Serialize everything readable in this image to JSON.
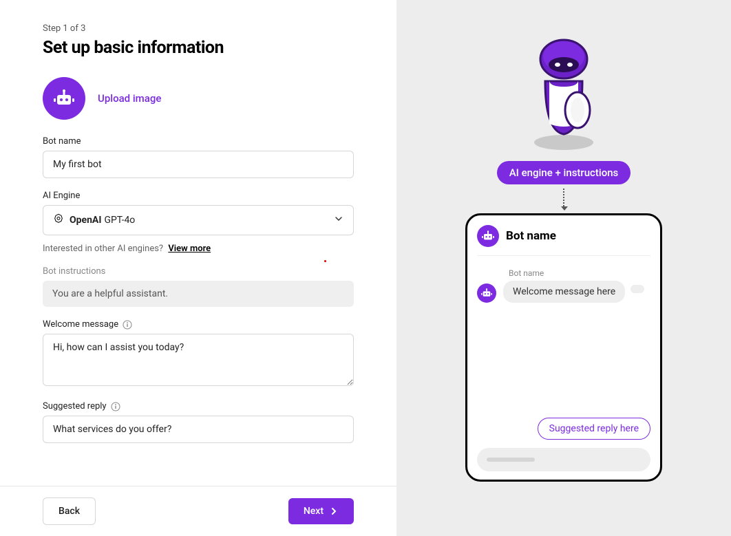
{
  "step": "Step 1 of 3",
  "title": "Set up basic information",
  "avatar": {
    "upload_label": "Upload image"
  },
  "form": {
    "bot_name_label": "Bot name",
    "bot_name_value": "My first bot",
    "engine_label": "AI Engine",
    "engine_brand": "OpenAI",
    "engine_model": "GPT-4o",
    "engine_hint_text": "Interested in other AI engines?",
    "engine_hint_link": "View more",
    "instructions_label": "Bot instructions",
    "instructions_value": "You are a helpful assistant.",
    "welcome_label": "Welcome message",
    "welcome_value": "Hi, how can I assist you today?",
    "suggested_label": "Suggested reply",
    "suggested_value": "What services do you offer?"
  },
  "footer": {
    "back": "Back",
    "next": "Next"
  },
  "preview": {
    "pill": "AI engine + instructions",
    "header_title": "Bot name",
    "bot_name": "Bot name",
    "welcome_bubble": "Welcome message here",
    "suggested_chip": "Suggested reply here"
  }
}
